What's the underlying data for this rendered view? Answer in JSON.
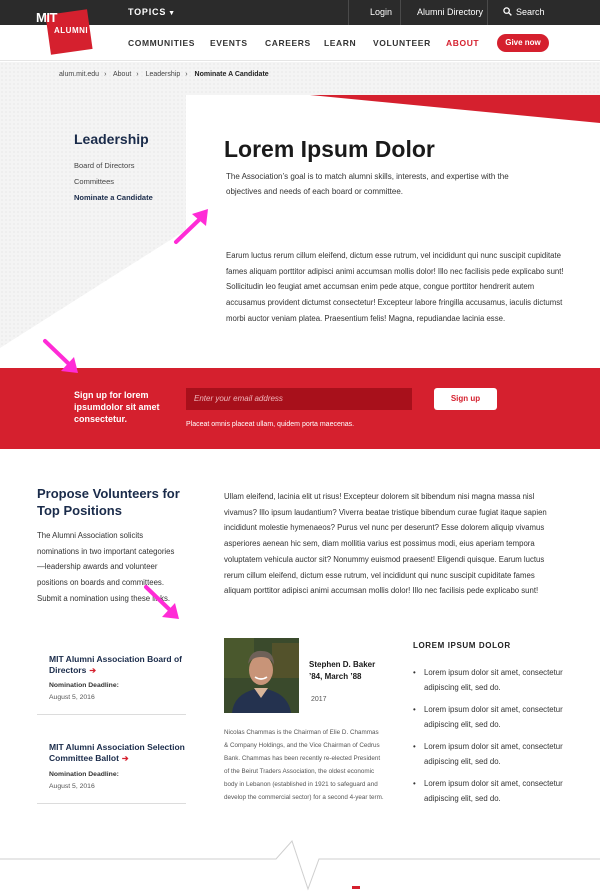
{
  "topbar": {
    "topics": "TOPICS",
    "login": "Login",
    "directory": "Alumni Directory",
    "search": "Search"
  },
  "logo": {
    "mit": "MIT",
    "alumni": "ALUMNI"
  },
  "nav": {
    "items": [
      "COMMUNITIES",
      "EVENTS",
      "CAREERS",
      "LEARN",
      "VOLUNTEER",
      "ABOUT"
    ],
    "active": "ABOUT",
    "give": "Give now"
  },
  "breadcrumb": [
    "alum.mit.edu",
    "About",
    "Leadership",
    "Nominate A Candidate"
  ],
  "sidebar": {
    "title": "Leadership",
    "links": [
      "Board of Directors",
      "Committees",
      "Nominate a Candidate"
    ]
  },
  "hero": {
    "title": "Lorem Ipsum Dolor",
    "desc": "The Association’s goal is to match alumni skills, interests, and expertise with the objectives and needs of each board or committee.",
    "body": "Earum luctus rerum cillum eleifend, dictum esse rutrum, vel incididunt qui nunc suscipit cupiditate fames aliquam porttitor adipisci animi accumsan mollis dolor! Illo nec facilisis pede explicabo sunt! Sollicitudin leo feugiat amet accumsan enim pede atque, congue porttitor hendrerit autem accusamus provident dictumst consectetur! Excepteur labore fringilla accusamus, iaculis dictumst morbi auctor veniam platea. Praesentium felis! Magna, repudiandae lacinia esse."
  },
  "signup": {
    "title": "Sign up for lorem ipsumdolor sit amet consectetur.",
    "placeholder": "Enter your email address",
    "button": "Sign up",
    "note": "Placeat omnis placeat ullam, quidem porta maecenas."
  },
  "propose": {
    "title": "Propose Volunteers for Top Positions",
    "text": "The Alumni Association solicits nominations in two important categories—leadership awards and volunteer positions on boards and committees. Submit a nomination using these links.",
    "links": [
      {
        "label": "MIT Alumni Association Board of Directors",
        "deadline_label": "Nomination Deadline:",
        "deadline": "August 5, 2016"
      },
      {
        "label": "MIT Alumni Association Selection Committee Ballot",
        "deadline_label": "Nomination Deadline:",
        "deadline": "August 5, 2016"
      }
    ]
  },
  "main": {
    "body": "Ullam eleifend, lacinia elit ut risus! Excepteur dolorem sit bibendum nisi magna massa nisl vivamus? Illo ipsum laudantium? Viverra beatae tristique bibendum curae fugiat itaque sapien incididunt molestie hymenaeos? Purus vel nunc per deserunt? Esse dolorem aliquip vivamus asperiores aenean hic sem, diam mollitia varius est possimus modi, eius aperiam tempora voluptatem vehicula auctor sit? Nonummy euismod praesent! Eligendi quisque. Earum luctus rerum cillum eleifend, dictum esse rutrum, vel incididunt qui nunc suscipit cupiditate fames aliquam porttitor adipisci animi accumsan mollis dolor! Illo nec facilisis pede explicabo sunt!"
  },
  "profile": {
    "name": "Stephen D. Baker ’84, March ’88",
    "year": "2017",
    "bio": "Nicolas Chammas is the Chairman of Elie D. Chammas & Company Holdings, and the Vice Chairman of Cedrus Bank. Chammas has been recently re-elected President of the Beirut Traders Association, the oldest economic body in Lebanon (established in 1921 to safeguard and develop the commercial sector) for a second 4-year term."
  },
  "list": {
    "title": "LOREM IPSUM DOLOR",
    "items": [
      "Lorem ipsum dolor sit amet, consectetur adipiscing elit, sed do.",
      "Lorem ipsum dolor sit amet, consectetur adipiscing elit, sed do.",
      "Lorem ipsum dolor sit amet, consectetur adipiscing elit, sed do.",
      "Lorem ipsum dolor sit amet, consectetur adipiscing elit, sed do."
    ]
  },
  "colors": {
    "brand_red": "#d5202e",
    "navy": "#1a2b4a",
    "annotation_arrow": "#ff2bd6",
    "topbar": "#2b2b2b"
  }
}
